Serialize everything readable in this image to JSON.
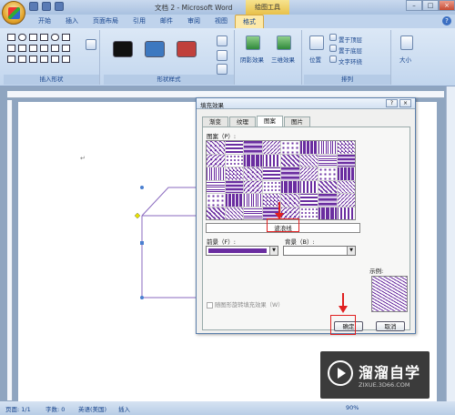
{
  "app": {
    "doc_title": "文档 2 - Microsoft Word",
    "context_title": "绘图工具"
  },
  "window_controls": {
    "minimize": "–",
    "maximize": "□",
    "close": "×"
  },
  "tabs": [
    {
      "label": "开始",
      "active": false
    },
    {
      "label": "插入",
      "active": false
    },
    {
      "label": "页面布局",
      "active": false
    },
    {
      "label": "引用",
      "active": false
    },
    {
      "label": "邮件",
      "active": false
    },
    {
      "label": "审阅",
      "active": false
    },
    {
      "label": "视图",
      "active": false
    },
    {
      "label": "格式",
      "active": true
    }
  ],
  "ribbon": {
    "insert_shapes_label": "插入形状",
    "shape_styles_label": "形状样式",
    "arrange_label": "排列",
    "shadow_effect": "阴影效果",
    "three_d_effect": "三维效果",
    "position": "位置",
    "bring_front": "置于顶层",
    "send_back": "置于底层",
    "text_wrap": "文字环绕",
    "size": "大小",
    "swatch_colors": [
      "#111111",
      "#3d78c0",
      "#c0403c"
    ]
  },
  "dialog": {
    "title": "填充效果",
    "help": "?",
    "close": "×",
    "tabs": [
      "渐变",
      "纹理",
      "图案",
      "图片"
    ],
    "active_tab": "图案",
    "pattern_label": "图案（P）:",
    "selected_pattern": "波浪线",
    "foreground_label": "前景（F）:",
    "background_label": "背景（B）:",
    "foreground_color": "#6a2da0",
    "sample_label": "示例:",
    "rotate_label": "随图形旋转填充效果（W）",
    "ok": "确定",
    "cancel": "取消"
  },
  "status": {
    "page": "页面: 1/1",
    "words": "字数: 0",
    "language": "英语(美国)",
    "mode": "插入",
    "zoom": "90%"
  },
  "watermark": {
    "title": "溜溜自学",
    "url": "ZIXUE.3D66.COM"
  },
  "doc_cursor": "↵"
}
